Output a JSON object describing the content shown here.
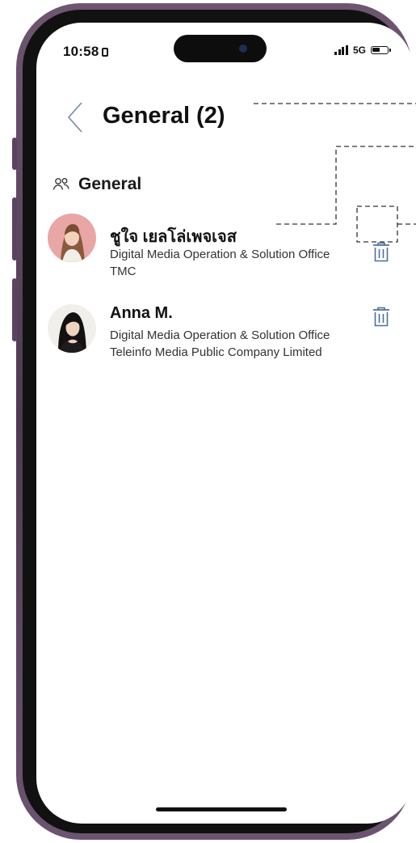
{
  "status_bar": {
    "time": "10:58",
    "network": "5G"
  },
  "header": {
    "title": "General (2)",
    "back_icon": "chevron-left-icon"
  },
  "section": {
    "title": "General",
    "icon": "group-icon"
  },
  "members": [
    {
      "name": "ชูใจ เยลโล่เพจเจส",
      "line1": "Digital Media Operation & Solution Office",
      "line2": "TMC",
      "avatar_bg": "#e8a6a4",
      "action_icon": "trash-icon"
    },
    {
      "name": "Anna M.",
      "line1": "Digital Media Operation & Solution Office",
      "line2": "Teleinfo Media Public Company Limited",
      "avatar_bg": "#f1efec",
      "action_icon": "trash-icon"
    }
  ],
  "colors": {
    "frame": "#5c465e",
    "back_chevron": "#7a8aa4",
    "trash": "#4d6fa0",
    "annotation_line": "#333333"
  }
}
